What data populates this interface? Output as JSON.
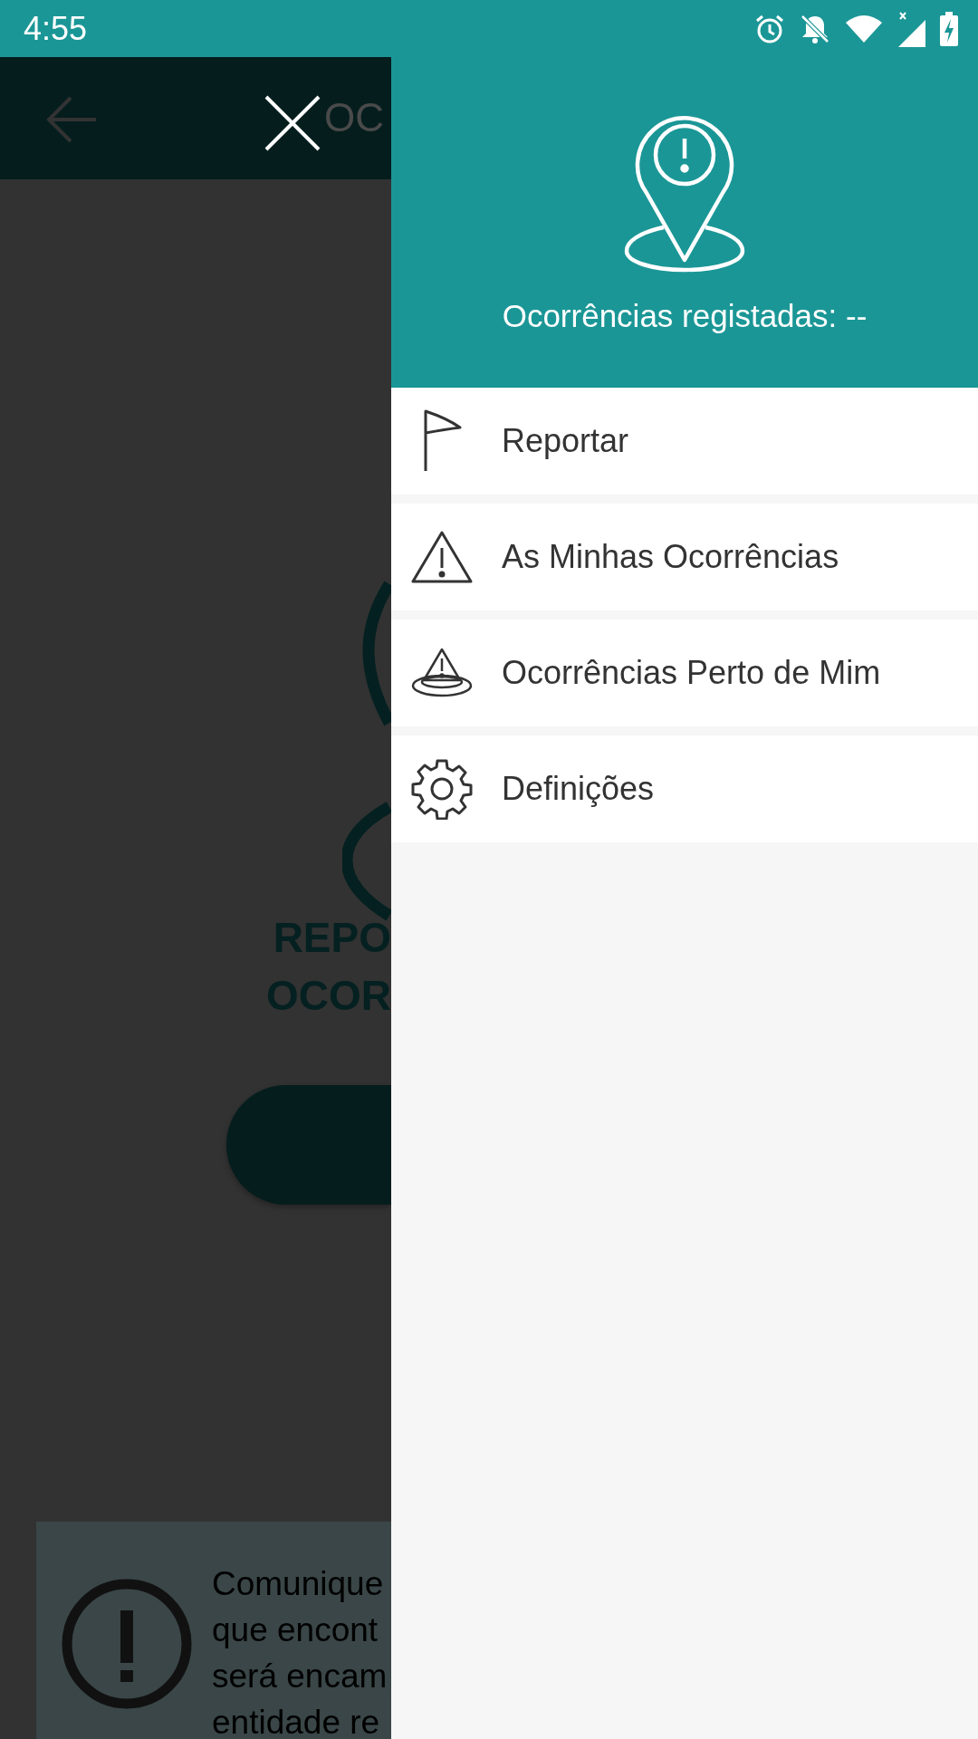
{
  "status_bar": {
    "time": "4:55"
  },
  "background_screen": {
    "title": "OC",
    "heading_lines": [
      "REPO",
      "OCOR"
    ],
    "notice_lines": [
      "Comunique",
      "que encont",
      "será encam",
      "entidade re"
    ]
  },
  "drawer": {
    "header": "Ocorrências registadas: --",
    "items": [
      {
        "label": "Reportar",
        "kind": "flag"
      },
      {
        "label": "As Minhas Ocorrências",
        "kind": "warning"
      },
      {
        "label": "Ocorrências Perto de Mim",
        "kind": "nearby"
      },
      {
        "label": "Definições",
        "kind": "settings"
      }
    ]
  }
}
